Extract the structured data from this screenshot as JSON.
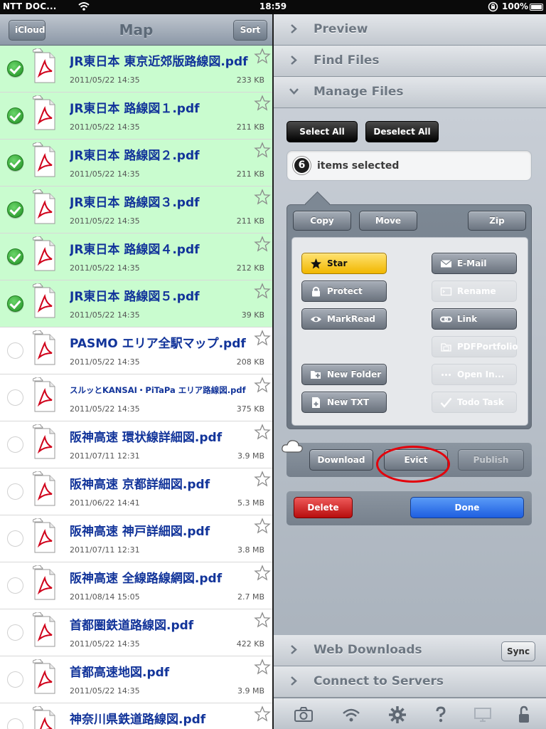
{
  "status": {
    "carrier": "NTT DOC...",
    "time": "18:59",
    "battery": "100%",
    "battery_level": 1.0
  },
  "nav": {
    "back_label": "iCloud",
    "title": "Map",
    "sort_label": "Sort"
  },
  "files": [
    {
      "name": "JR東日本 東京近郊版路線図.pdf",
      "date": "2011/05/22 14:35",
      "size": "233 KB",
      "selected": true,
      "small": false
    },
    {
      "name": "JR東日本 路線図１.pdf",
      "date": "2011/05/22 14:35",
      "size": "211 KB",
      "selected": true,
      "small": false
    },
    {
      "name": "JR東日本 路線図２.pdf",
      "date": "2011/05/22 14:35",
      "size": "211 KB",
      "selected": true,
      "small": false
    },
    {
      "name": "JR東日本 路線図３.pdf",
      "date": "2011/05/22 14:35",
      "size": "211 KB",
      "selected": true,
      "small": false
    },
    {
      "name": "JR東日本 路線図４.pdf",
      "date": "2011/05/22 14:35",
      "size": "212 KB",
      "selected": true,
      "small": false
    },
    {
      "name": "JR東日本 路線図５.pdf",
      "date": "2011/05/22 14:35",
      "size": "39 KB",
      "selected": true,
      "small": false
    },
    {
      "name": "PASMO エリア全駅マップ.pdf",
      "date": "2011/05/22 14:35",
      "size": "208 KB",
      "selected": false,
      "small": false
    },
    {
      "name": "スルッとKANSAI・PiTaPa エリア路線図.pdf",
      "date": "2011/05/22 14:35",
      "size": "375 KB",
      "selected": false,
      "small": true
    },
    {
      "name": "阪神高速 環状線詳細図.pdf",
      "date": "2011/07/11 12:31",
      "size": "3.9 MB",
      "selected": false,
      "small": false
    },
    {
      "name": "阪神高速 京都詳細図.pdf",
      "date": "2011/06/22 14:41",
      "size": "5.3 MB",
      "selected": false,
      "small": false
    },
    {
      "name": "阪神高速 神戸詳細図.pdf",
      "date": "2011/07/11 12:31",
      "size": "3.8 MB",
      "selected": false,
      "small": false
    },
    {
      "name": "阪神高速 全線路線網図.pdf",
      "date": "2011/08/14 15:05",
      "size": "2.7 MB",
      "selected": false,
      "small": false
    },
    {
      "name": "首都圏鉄道路線図.pdf",
      "date": "2011/05/22 14:35",
      "size": "422 KB",
      "selected": false,
      "small": false
    },
    {
      "name": "首都高速地図.pdf",
      "date": "2011/05/22 14:35",
      "size": "3.9 MB",
      "selected": false,
      "small": false
    },
    {
      "name": "神奈川県鉄道路線図.pdf",
      "date": "",
      "size": "",
      "selected": false,
      "small": false
    }
  ],
  "sections": {
    "preview": "Preview",
    "find": "Find Files",
    "manage": "Manage Files",
    "web": "Web Downloads",
    "connect": "Connect to Servers"
  },
  "manage": {
    "select_all": "Select All",
    "deselect_all": "Deselect All",
    "count": "6",
    "count_label": "items selected",
    "copy": "Copy",
    "move": "Move",
    "zip": "Zip",
    "star": "Star",
    "email": "E-Mail",
    "protect": "Protect",
    "rename": "Rename",
    "markread": "MarkRead",
    "link": "Link",
    "pdfportfolio": "PDFPortfolio",
    "new_folder": "New Folder",
    "open_in": "Open In...",
    "new_txt": "New TXT",
    "todo": "Todo Task",
    "download": "Download",
    "evict": "Evict",
    "publish": "Publish",
    "delete": "Delete",
    "done": "Done",
    "sync": "Sync"
  },
  "icons": {
    "toolbar": [
      "camera-icon",
      "wifi-icon",
      "gear-icon",
      "help-icon",
      "monitor-icon",
      "unlock-icon"
    ]
  },
  "colors": {
    "selected_row": "#c9fccf",
    "file_name": "#12349a",
    "star_button": "#f1b700",
    "delete": "#d12a2a",
    "done": "#2b6ce6",
    "highlight_circle": "#e3000b"
  }
}
